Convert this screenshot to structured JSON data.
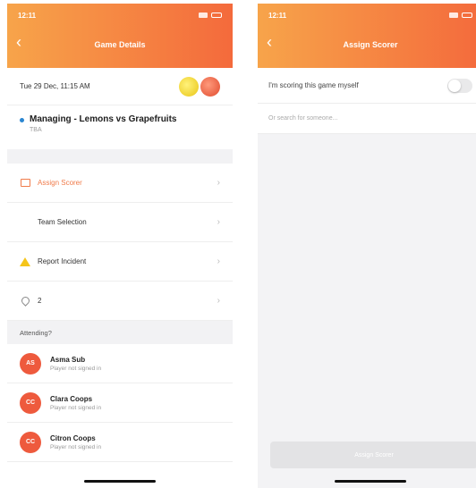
{
  "left": {
    "status": {
      "time": "12:11"
    },
    "header": {
      "title": "Game Details"
    },
    "date": "Tue 29 Dec, 11:15 AM",
    "event": {
      "title": "Managing - Lemons vs Grapefruits",
      "subtitle": "TBA"
    },
    "menu": [
      {
        "label": "Assign Scorer"
      },
      {
        "label": "Team Selection"
      },
      {
        "label": "Report Incident"
      },
      {
        "label": "2"
      }
    ],
    "attending_header": "Attending?",
    "players": [
      {
        "initials": "AS",
        "name": "Asma Sub",
        "status": "Player not signed in"
      },
      {
        "initials": "CC",
        "name": "Clara Coops",
        "status": "Player not signed in"
      },
      {
        "initials": "CC",
        "name": "Citron Coops",
        "status": "Player not signed in"
      }
    ]
  },
  "right": {
    "status": {
      "time": "12:11"
    },
    "header": {
      "title": "Assign Scorer"
    },
    "toggle_label": "I'm scoring this game myself",
    "search_placeholder": "Or search for someone...",
    "assign_button": "Assign Scorer"
  },
  "colors": {
    "header_gradient_start": "#f7a44a",
    "header_gradient_end": "#f46a3c",
    "accent": "#f07b4a",
    "avatar": "#ee5a3d"
  }
}
